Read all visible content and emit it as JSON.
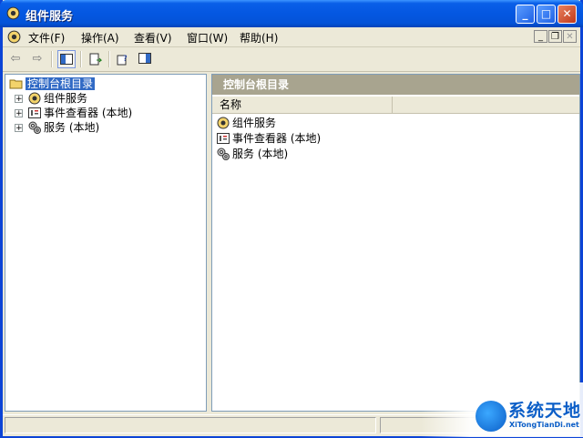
{
  "window": {
    "title": "组件服务"
  },
  "menu": {
    "items": [
      "文件(F)",
      "操作(A)",
      "查看(V)",
      "窗口(W)",
      "帮助(H)"
    ]
  },
  "tree": {
    "root": "控制台根目录",
    "children": [
      "组件服务",
      "事件查看器 (本地)",
      "服务 (本地)"
    ]
  },
  "right_pane": {
    "header": "控制台根目录",
    "column": "名称",
    "items": [
      "组件服务",
      "事件查看器 (本地)",
      "服务 (本地)"
    ]
  },
  "watermark": {
    "title": "系统天地",
    "subtitle": "XiTongTianDi.net"
  },
  "colors": {
    "title_bar": "#0457e1",
    "selection": "#316ac5",
    "pane_header": "#a8a48f"
  }
}
